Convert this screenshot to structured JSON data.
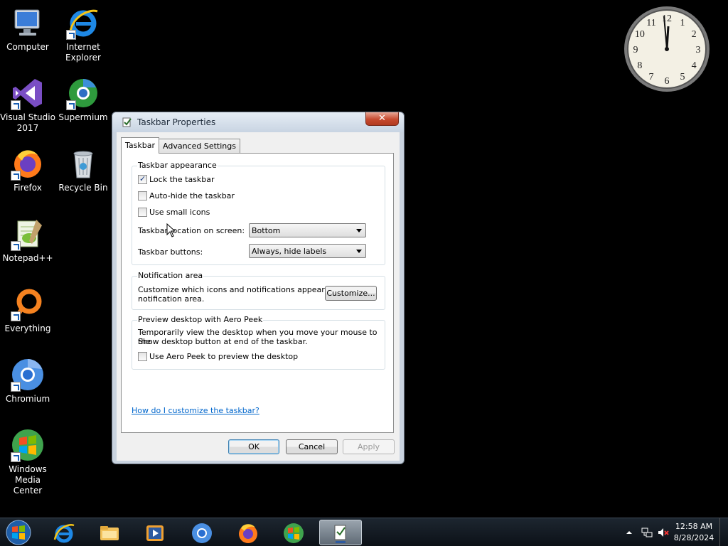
{
  "desktop": {
    "icons": [
      {
        "label": "Computer"
      },
      {
        "label": "Internet\nExplorer"
      },
      {
        "label": "Visual Studio\n2017"
      },
      {
        "label": "Supermium"
      },
      {
        "label": "Firefox"
      },
      {
        "label": "Recycle Bin"
      },
      {
        "label": "Notepad++"
      },
      {
        "label": "Everything"
      },
      {
        "label": "Chromium"
      },
      {
        "label": "Windows\nMedia Center"
      }
    ]
  },
  "clock": {
    "time_shown": "12:58",
    "numerals": [
      "12",
      "1",
      "2",
      "3",
      "4",
      "5",
      "6",
      "7",
      "8",
      "9",
      "10",
      "11"
    ]
  },
  "dialog": {
    "title": "Taskbar Properties",
    "close_label": "✕",
    "tabs": [
      {
        "label": "Taskbar",
        "active": true
      },
      {
        "label": "Advanced Settings",
        "active": false
      }
    ],
    "appearance": {
      "title": "Taskbar appearance",
      "lock": {
        "label": "Lock the taskbar",
        "checked": true
      },
      "autohide": {
        "label": "Auto-hide the taskbar",
        "checked": false
      },
      "small_icons": {
        "label": "Use small icons",
        "checked": false
      },
      "location_label": "Taskbar location on screen:",
      "location_value": "Bottom",
      "buttons_label": "Taskbar buttons:",
      "buttons_value": "Always, hide labels"
    },
    "notification": {
      "title": "Notification area",
      "text_line1": "Customize which icons and notifications appear in the",
      "text_line2": "notification area.",
      "customize_label": "Customize..."
    },
    "peek": {
      "title": "Preview desktop with Aero Peek",
      "text_line1": "Temporarily view the desktop when you move your mouse to the",
      "text_line2": "Show desktop button at end of the taskbar.",
      "use_peek": {
        "label": "Use Aero Peek to preview the desktop",
        "checked": false
      }
    },
    "help_link": "How do I customize the taskbar?",
    "ok_label": "OK",
    "cancel_label": "Cancel",
    "apply_label": "Apply"
  },
  "taskbar": {
    "time": "12:58 AM",
    "date": "8/28/2024"
  }
}
